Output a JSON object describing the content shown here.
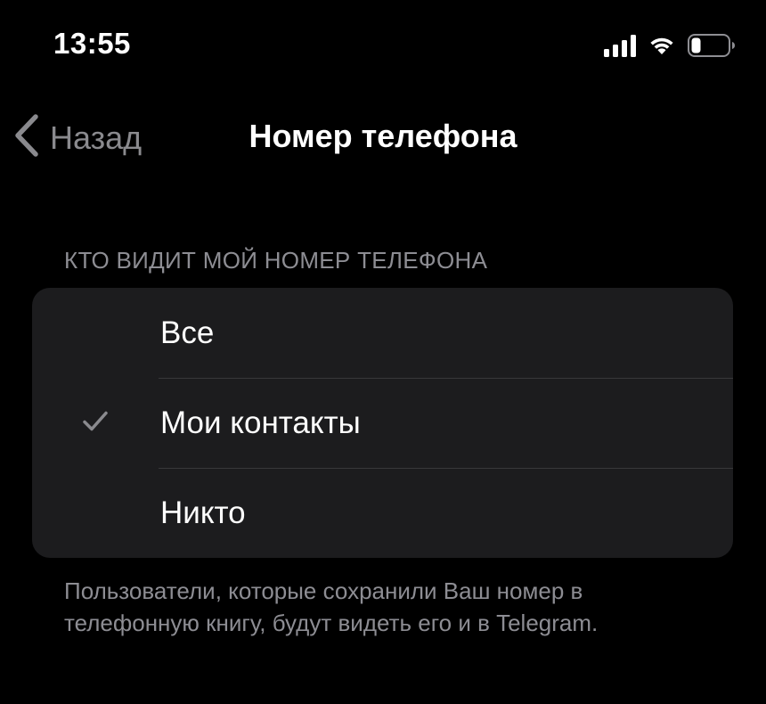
{
  "status_bar": {
    "time": "13:55",
    "icons": [
      "signal-icon",
      "wifi-icon",
      "battery-icon"
    ]
  },
  "nav": {
    "back_label": "Назад",
    "title": "Номер телефона"
  },
  "section": {
    "header": "КТО ВИДИТ МОЙ НОМЕР ТЕЛЕФОНА",
    "options": [
      {
        "label": "Все",
        "selected": false
      },
      {
        "label": "Мои контакты",
        "selected": true
      },
      {
        "label": "Никто",
        "selected": false
      }
    ],
    "footer": "Пользователи, которые сохранили Ваш номер в телефонную книгу, будут видеть его и в Telegram."
  },
  "colors": {
    "background": "#000000",
    "group_background": "#1c1c1e",
    "secondary_text": "#8d8d93",
    "checkmark": "#8a8a8e"
  }
}
